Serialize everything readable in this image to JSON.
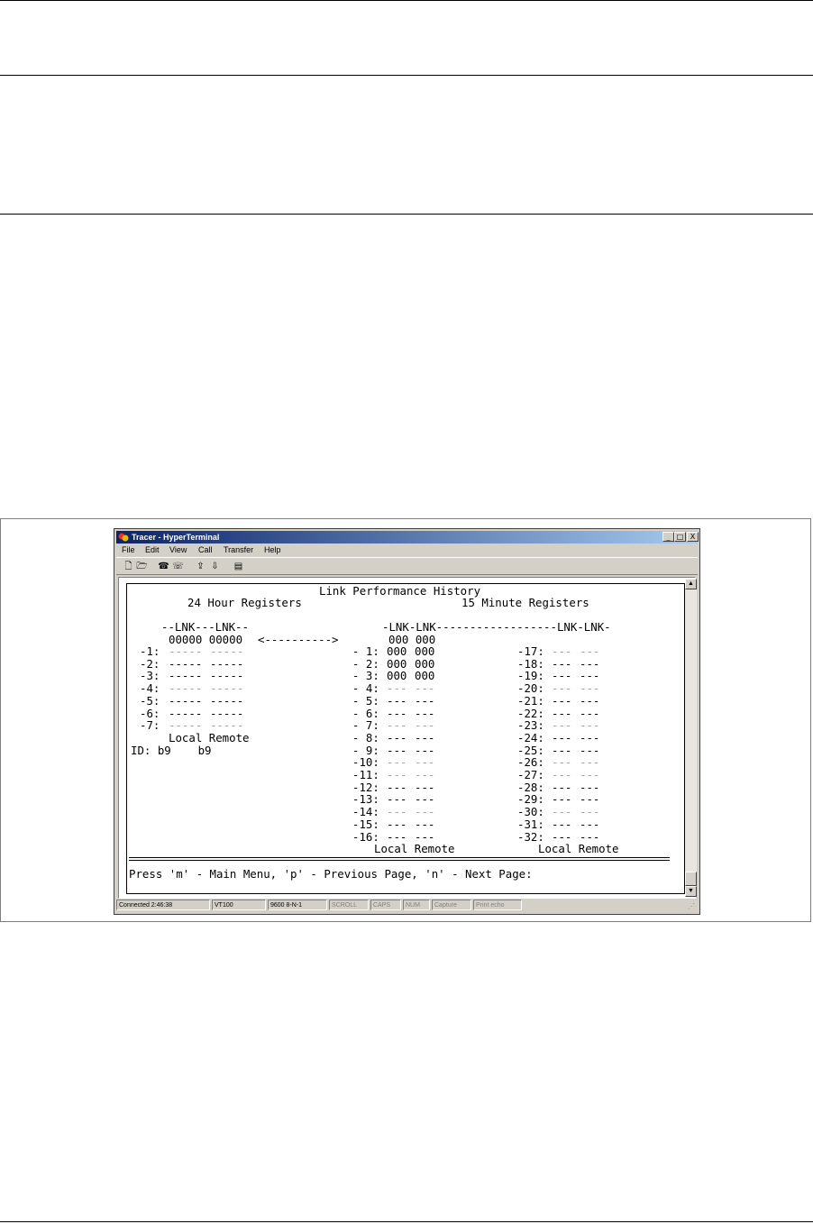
{
  "window": {
    "title": "Tracer - HyperTerminal",
    "buttons": [
      "_",
      "□",
      "X"
    ]
  },
  "menu": [
    "File",
    "Edit",
    "View",
    "Call",
    "Transfer",
    "Help"
  ],
  "toolbar_icons": [
    "new-icon",
    "open-icon",
    "phone-icon",
    "disconnect-icon",
    "send-icon",
    "receive-icon",
    "properties-icon"
  ],
  "terminal": {
    "heading": "Link Performance History",
    "left_title": "24 Hour Registers",
    "right_title": "15 Minute Registers",
    "left_header": "--LNK---LNK--",
    "left_current": "00000 00000",
    "arrow": "<---------->",
    "left_rows": [
      {
        "label": "-1:",
        "local": "-----",
        "remote": "-----",
        "dim": true
      },
      {
        "label": "-2:",
        "local": "-----",
        "remote": "-----",
        "dim": false
      },
      {
        "label": "-3:",
        "local": "-----",
        "remote": "-----",
        "dim": false
      },
      {
        "label": "-4:",
        "local": "-----",
        "remote": "-----",
        "dim": true
      },
      {
        "label": "-5:",
        "local": "-----",
        "remote": "-----",
        "dim": false
      },
      {
        "label": "-6:",
        "local": "-----",
        "remote": "-----",
        "dim": false
      },
      {
        "label": "-7:",
        "local": "-----",
        "remote": "-----",
        "dim": true
      }
    ],
    "left_footer": "Local Remote",
    "id_line": "ID: b9    b9",
    "mid_header": "-LNK-LNK------------------LNK-LNK-",
    "mid_current": "000 000",
    "mid_rows": [
      {
        "label": "- 1:",
        "local": "000",
        "remote": "000",
        "dim": false
      },
      {
        "label": "- 2:",
        "local": "000",
        "remote": "000",
        "dim": false
      },
      {
        "label": "- 3:",
        "local": "000",
        "remote": "000",
        "dim": false
      },
      {
        "label": "- 4:",
        "local": "---",
        "remote": "---",
        "dim": true
      },
      {
        "label": "- 5:",
        "local": "---",
        "remote": "---",
        "dim": false
      },
      {
        "label": "- 6:",
        "local": "---",
        "remote": "---",
        "dim": false
      },
      {
        "label": "- 7:",
        "local": "---",
        "remote": "---",
        "dim": true
      },
      {
        "label": "- 8:",
        "local": "---",
        "remote": "---",
        "dim": false
      },
      {
        "label": "- 9:",
        "local": "---",
        "remote": "---",
        "dim": false
      },
      {
        "label": "-10:",
        "local": "---",
        "remote": "---",
        "dim": true
      },
      {
        "label": "-11:",
        "local": "---",
        "remote": "---",
        "dim": true
      },
      {
        "label": "-12:",
        "local": "---",
        "remote": "---",
        "dim": false
      },
      {
        "label": "-13:",
        "local": "---",
        "remote": "---",
        "dim": false
      },
      {
        "label": "-14:",
        "local": "---",
        "remote": "---",
        "dim": true
      },
      {
        "label": "-15:",
        "local": "---",
        "remote": "---",
        "dim": false
      },
      {
        "label": "-16:",
        "local": "---",
        "remote": "---",
        "dim": false
      }
    ],
    "right_rows": [
      {
        "label": "-17:",
        "local": "---",
        "remote": "---",
        "dim": true
      },
      {
        "label": "-18:",
        "local": "---",
        "remote": "---",
        "dim": false
      },
      {
        "label": "-19:",
        "local": "---",
        "remote": "---",
        "dim": false
      },
      {
        "label": "-20:",
        "local": "---",
        "remote": "---",
        "dim": true
      },
      {
        "label": "-21:",
        "local": "---",
        "remote": "---",
        "dim": false
      },
      {
        "label": "-22:",
        "local": "---",
        "remote": "---",
        "dim": false
      },
      {
        "label": "-23:",
        "local": "---",
        "remote": "---",
        "dim": true
      },
      {
        "label": "-24:",
        "local": "---",
        "remote": "---",
        "dim": false
      },
      {
        "label": "-25:",
        "local": "---",
        "remote": "---",
        "dim": false
      },
      {
        "label": "-26:",
        "local": "---",
        "remote": "---",
        "dim": true
      },
      {
        "label": "-27:",
        "local": "---",
        "remote": "---",
        "dim": true
      },
      {
        "label": "-28:",
        "local": "---",
        "remote": "---",
        "dim": false
      },
      {
        "label": "-29:",
        "local": "---",
        "remote": "---",
        "dim": false
      },
      {
        "label": "-30:",
        "local": "---",
        "remote": "---",
        "dim": true
      },
      {
        "label": "-31:",
        "local": "---",
        "remote": "---",
        "dim": false
      },
      {
        "label": "-32:",
        "local": "---",
        "remote": "---",
        "dim": false
      }
    ],
    "mid_footer": "Local Remote",
    "right_footer": "Local Remote",
    "prompt": "Press 'm' - Main Menu, 'p' - Previous Page, 'n' - Next Page:"
  },
  "status": [
    "Connected 2:46:38",
    "VT100",
    "9600 8-N-1",
    "SCROLL",
    "CAPS",
    "NUM",
    "Capture",
    "Print echo"
  ]
}
